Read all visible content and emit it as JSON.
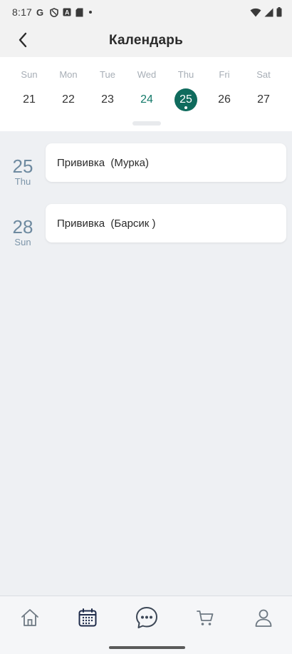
{
  "status_bar": {
    "time": "8:17",
    "left_icons": [
      "google-g-icon",
      "shield-icon",
      "a-box-icon",
      "sd-card-icon",
      "dot-icon"
    ],
    "right_icons": [
      "wifi-icon",
      "signal-icon",
      "battery-icon"
    ]
  },
  "header": {
    "title": "Календарь",
    "back_icon": "chevron-left-icon"
  },
  "week": {
    "days": [
      {
        "name": "Sun",
        "num": "21",
        "state": "normal"
      },
      {
        "name": "Mon",
        "num": "22",
        "state": "normal"
      },
      {
        "name": "Tue",
        "num": "23",
        "state": "normal"
      },
      {
        "name": "Wed",
        "num": "24",
        "state": "today"
      },
      {
        "name": "Thu",
        "num": "25",
        "state": "selected"
      },
      {
        "name": "Fri",
        "num": "26",
        "state": "normal"
      },
      {
        "name": "Sat",
        "num": "27",
        "state": "normal"
      }
    ]
  },
  "events": [
    {
      "day": "25",
      "weekday": "Thu",
      "title": "Прививка  (Мурка)"
    },
    {
      "day": "28",
      "weekday": "Sun",
      "title": "Прививка  (Барсик )"
    }
  ],
  "nav": {
    "items": [
      {
        "icon": "home-icon",
        "active": false
      },
      {
        "icon": "calendar-icon",
        "active": true
      },
      {
        "icon": "chat-icon",
        "active": false
      },
      {
        "icon": "cart-icon",
        "active": false
      },
      {
        "icon": "profile-icon",
        "active": false
      }
    ]
  },
  "colors": {
    "accent": "#0f6b5d",
    "today": "#147a6a",
    "date_badge": "#6e8aa0",
    "background": "#eef0f3"
  }
}
